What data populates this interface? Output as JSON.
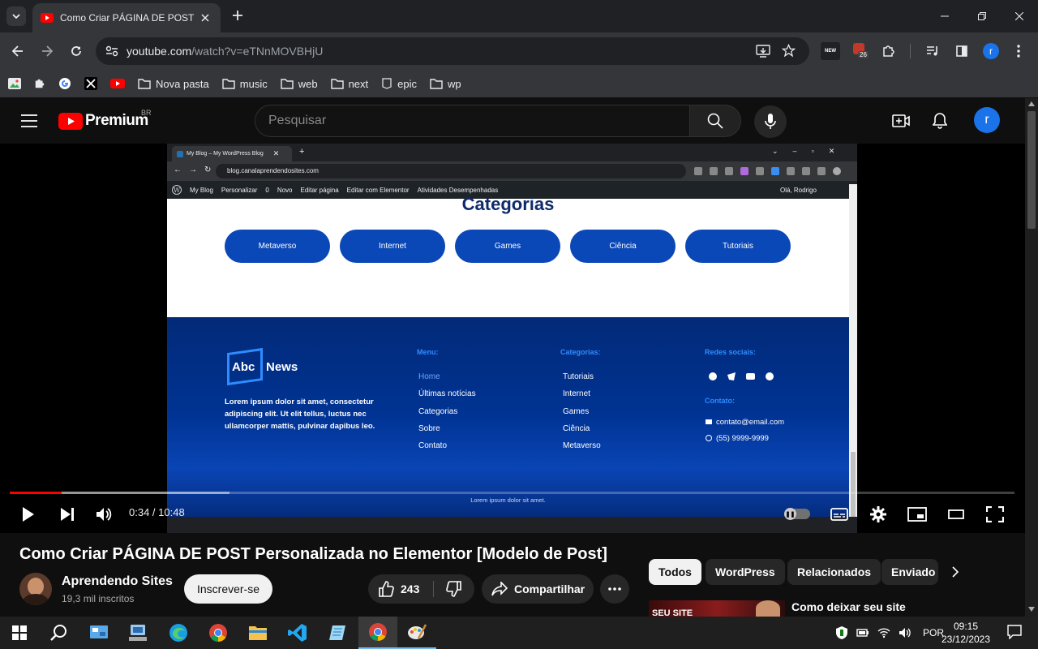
{
  "browser": {
    "tab_title": "Como Criar PÁGINA DE POST Pe",
    "url_host": "youtube.com",
    "url_path": "/watch?v=eTNnMOVBHjU",
    "extension_badge": "26",
    "profile_initial": "r",
    "bookmarks": [
      "Nova pasta",
      "music",
      "web",
      "next",
      "epic",
      "wp"
    ]
  },
  "youtube": {
    "logo": "Premium",
    "region": "BR",
    "search_placeholder": "Pesquisar",
    "avatar_initial": "r"
  },
  "video": {
    "inner_browser": {
      "tab_title": "My Blog – My WordPress Blog",
      "url": "blog.canalaprendendosites.com",
      "wp_bar": [
        "My Blog",
        "Personalizar",
        "0",
        "Novo",
        "Editar página",
        "Editar com Elementor",
        "Atividades Desempenhadas"
      ],
      "wp_user": "Olá, Rodrigo"
    },
    "categories_title": "Categorias",
    "categories": [
      "Metaverso",
      "Internet",
      "Games",
      "Ciência",
      "Tutoriais"
    ],
    "footer": {
      "logo_abc": "Abc",
      "logo_news": "News",
      "about": "Lorem ipsum dolor sit amet, consectetur adipiscing elit. Ut elit tellus, luctus nec ullamcorper mattis, pulvinar dapibus leo.",
      "menu_heading": "Menu:",
      "menu": [
        "Home",
        "Últimas notícias",
        "Categorias",
        "Sobre",
        "Contato"
      ],
      "cat_heading": "Categorias:",
      "cats": [
        "Tutoriais",
        "Internet",
        "Games",
        "Ciência",
        "Metaverso"
      ],
      "social_heading": "Redes sociais:",
      "contact_heading": "Contato:",
      "email": "contato@email.com",
      "phone": "(55) 9999-9999",
      "copyright": "Lorem ipsum dolor sit amet."
    },
    "time": "0:34 / 10:48",
    "progress_played": 0.052,
    "progress_buffered": 0.219,
    "title": "Como Criar PÁGINA DE POST Personalizada no Elementor [Modelo de Post]",
    "channel": "Aprendendo Sites",
    "subscribers": "19,3 mil inscritos",
    "subscribe_label": "Inscrever-se",
    "likes": "243",
    "share_label": "Compartilhar"
  },
  "chips": [
    "Todos",
    "WordPress",
    "Relacionados",
    "Enviado"
  ],
  "recommendation": {
    "title": "Como deixar seu site",
    "thumb_text": "SEU SITE"
  },
  "taskbar": {
    "language": "POR",
    "time": "09:15",
    "date": "23/12/2023"
  }
}
